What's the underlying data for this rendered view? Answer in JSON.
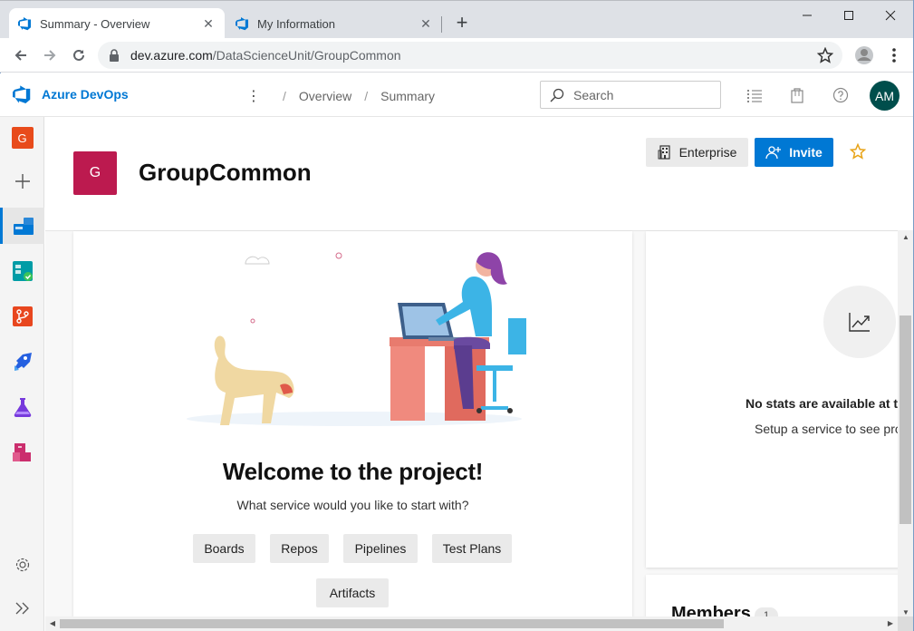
{
  "browser": {
    "tabs": [
      {
        "title": "Summary - Overview",
        "close": "✕"
      },
      {
        "title": "My Information",
        "close": "✕"
      }
    ],
    "new_tab": "+",
    "window_controls": {
      "minimize": "—",
      "maximize": "☐",
      "close": "✕"
    },
    "url_host": "dev.azure.com",
    "url_path": "/DataScienceUnit/GroupCommon"
  },
  "header": {
    "brand": "Azure DevOps",
    "breadcrumbs": [
      "Overview",
      "Summary"
    ],
    "breadcrumb_sep": "/",
    "more": "⋮",
    "search_placeholder": "Search",
    "avatar_initials": "AM",
    "icons": [
      "list-settings-icon",
      "marketplace-bag-icon",
      "help-icon"
    ]
  },
  "leftnav": {
    "project_initial": "G",
    "items": [
      "new-icon",
      "overview-icon",
      "boards-icon",
      "repos-icon",
      "pipelines-icon",
      "test-plans-icon",
      "artifacts-icon",
      "settings-icon",
      "collapse-icon"
    ],
    "add": "+",
    "collapse": "»"
  },
  "project": {
    "initial": "G",
    "name": "GroupCommon",
    "enterprise_label": "Enterprise",
    "invite_label": "Invite",
    "favorite": "☆"
  },
  "welcome": {
    "title": "Welcome to the project!",
    "subtitle": "What service would you like to start with?",
    "services": [
      "Boards",
      "Repos",
      "Pipelines",
      "Test Plans",
      "Artifacts"
    ]
  },
  "stats": {
    "title": "No stats are available at t",
    "subtitle": "Setup a service to see pro"
  },
  "members": {
    "title": "Members",
    "count": "1"
  },
  "colors": {
    "accent": "#0078d4",
    "project_avatar": "#bc1a4f",
    "user_avatar": "#004e4c",
    "org_badge": "#e84b1b"
  }
}
